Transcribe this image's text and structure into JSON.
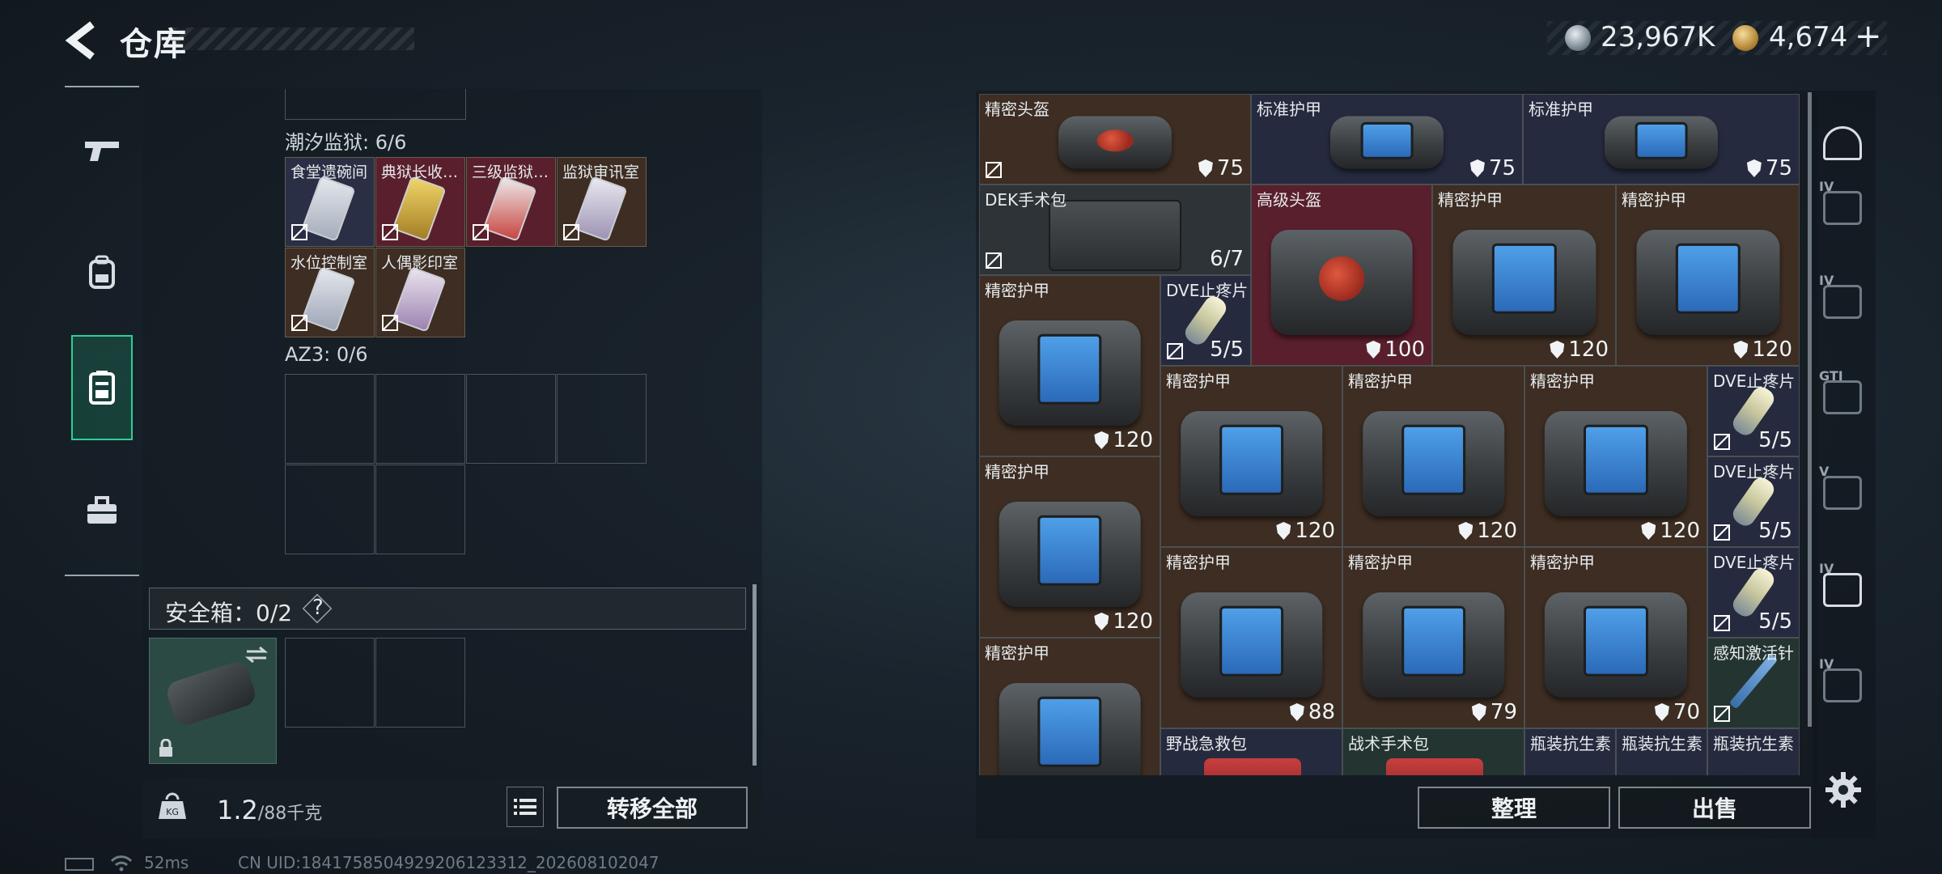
{
  "header": {
    "title": "仓库"
  },
  "currency": {
    "silver": "23,967K",
    "gold": "4,674",
    "add_label": "+"
  },
  "left_nav": [
    "weapon-icon",
    "backpack-icon",
    "vest-icon",
    "toolbox-icon"
  ],
  "container": {
    "section1_label": "潮汐监狱: 6/6",
    "cards": [
      {
        "label": "食堂遗碗间",
        "tint": "#c2c8d6"
      },
      {
        "label": "典狱长收…",
        "tint": "#d8b44a"
      },
      {
        "label": "三级监狱…",
        "tint": "#c63e39"
      },
      {
        "label": "监狱审讯室",
        "tint": "#b9b0c8"
      },
      {
        "label": "水位控制室",
        "tint": "#b7bfcb"
      },
      {
        "label": "人偶影印室",
        "tint": "#b59bbf"
      }
    ],
    "section2_label": "AZ3: 0/6"
  },
  "safe_box": {
    "label": "安全箱：0/2",
    "help": "?"
  },
  "weight": {
    "value": "1.2",
    "max": "/88千克"
  },
  "buttons": {
    "transfer_all": "转移全部",
    "sort": "整理",
    "sell": "出售"
  },
  "status": {
    "ping": "52ms",
    "uid": "CN UID:1841758504929206123312_202608102047"
  },
  "warehouse": [
    {
      "name": "精密头盔",
      "value": "75",
      "kind": "helmet",
      "bg": "brown",
      "shield": true,
      "nt": true
    },
    {
      "name": "标准护甲",
      "value": "75",
      "kind": "armor",
      "bg": "navy",
      "shield": true,
      "nt": false
    },
    {
      "name": "标准护甲",
      "value": "75",
      "kind": "armor",
      "bg": "navy",
      "shield": true,
      "nt": false
    },
    {
      "name": "DEK手术包",
      "value": "6/7",
      "kind": "kit",
      "bg": "gray",
      "shield": false,
      "nt": true
    },
    {
      "name": "高级头盔",
      "value": "100",
      "kind": "helmet-big",
      "bg": "red",
      "shield": true,
      "nt": false
    },
    {
      "name": "精密护甲",
      "value": "120",
      "kind": "armor",
      "bg": "brown",
      "shield": true,
      "nt": false
    },
    {
      "name": "精密护甲",
      "value": "120",
      "kind": "armor",
      "bg": "brown",
      "shield": true,
      "nt": false
    },
    {
      "name": "精密护甲",
      "value": "120",
      "kind": "armor",
      "bg": "brown",
      "shield": true,
      "nt": false
    },
    {
      "name": "DVE止疼片",
      "value": "5/5",
      "kind": "pill",
      "bg": "navy",
      "shield": false,
      "nt": true
    },
    {
      "name": "精密护甲",
      "value": "120",
      "kind": "armor",
      "bg": "brown",
      "shield": true,
      "nt": false
    },
    {
      "name": "精密护甲",
      "value": "120",
      "kind": "armor",
      "bg": "brown",
      "shield": true,
      "nt": false
    },
    {
      "name": "精密护甲",
      "value": "120",
      "kind": "armor",
      "bg": "brown",
      "shield": true,
      "nt": false
    },
    {
      "name": "DVE止疼片",
      "value": "5/5",
      "kind": "pill",
      "bg": "navy",
      "shield": false,
      "nt": true
    },
    {
      "name": "精密护甲",
      "value": "120",
      "kind": "armor",
      "bg": "brown",
      "shield": true,
      "nt": false
    },
    {
      "name": "DVE止疼片",
      "value": "5/5",
      "kind": "pill",
      "bg": "navy",
      "shield": false,
      "nt": true
    },
    {
      "name": "精密护甲",
      "value": "88",
      "kind": "armor",
      "bg": "brown",
      "shield": true,
      "nt": false
    },
    {
      "name": "精密护甲",
      "value": "79",
      "kind": "armor",
      "bg": "brown",
      "shield": true,
      "nt": false
    },
    {
      "name": "精密护甲",
      "value": "70",
      "kind": "armor",
      "bg": "brown",
      "shield": true,
      "nt": false
    },
    {
      "name": "DVE止疼片",
      "value": "5/5",
      "kind": "pill",
      "bg": "navy",
      "shield": false,
      "nt": true
    },
    {
      "name": "精密护甲",
      "value": "",
      "kind": "armor",
      "bg": "brown",
      "shield": false,
      "nt": false
    },
    {
      "name": "感知激活针",
      "value": "",
      "kind": "syringe",
      "bg": "teal",
      "shield": false,
      "nt": true
    },
    {
      "name": "野战急救包",
      "value": "",
      "kind": "redkit",
      "bg": "navy",
      "shield": false,
      "nt": false
    },
    {
      "name": "战术手术包",
      "value": "",
      "kind": "redkit",
      "bg": "teal",
      "shield": false,
      "nt": false
    },
    {
      "name": "瓶装抗生素",
      "value": "",
      "kind": "bottle",
      "bg": "navy",
      "shield": false,
      "nt": false
    },
    {
      "name": "瓶装抗生素",
      "value": "",
      "kind": "bottle",
      "bg": "navy",
      "shield": false,
      "nt": false
    },
    {
      "name": "瓶装抗生素",
      "value": "",
      "kind": "bottle",
      "bg": "navy",
      "shield": false,
      "nt": false
    }
  ],
  "right_nav": [
    {
      "icon": "helmet-category-icon",
      "badge": ""
    },
    {
      "icon": "armor-lv4-icon",
      "badge": "IV"
    },
    {
      "icon": "armor-lv4-b-icon",
      "badge": "IV"
    },
    {
      "icon": "gti-category-icon",
      "badge": "GTI"
    },
    {
      "icon": "lv5-category-icon",
      "badge": "V"
    },
    {
      "icon": "lv4-add-icon",
      "badge": "IV"
    },
    {
      "icon": "lv4-add-dim-icon",
      "badge": "IV"
    }
  ],
  "colors": {
    "accent": "#2ccf96",
    "brown": "#3d2d22",
    "navy": "#262a3e",
    "red": "#5a1f2c"
  }
}
